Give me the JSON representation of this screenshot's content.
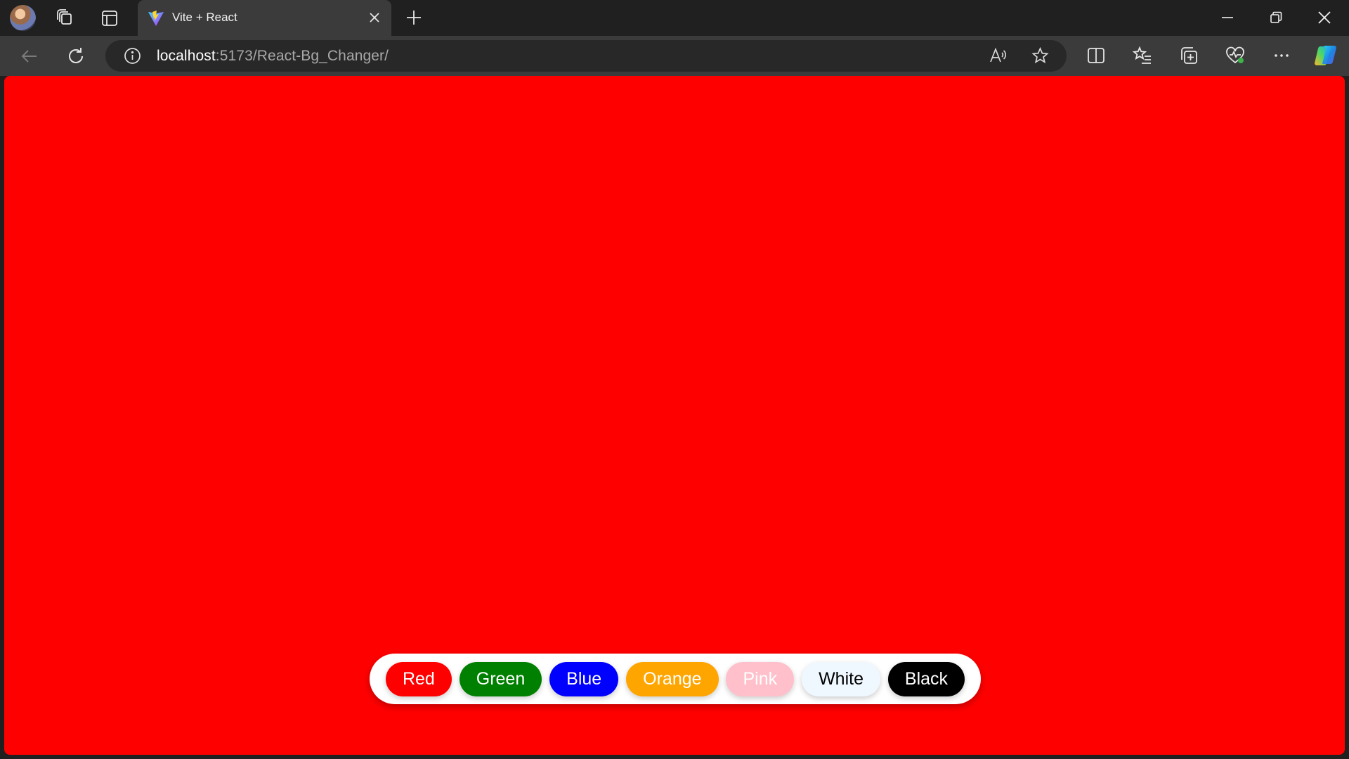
{
  "browser": {
    "tab": {
      "title": "Vite + React"
    },
    "address": {
      "host": "localhost",
      "path": ":5173/React-Bg_Changer/"
    }
  },
  "page": {
    "background_color": "#ff0000",
    "buttons": [
      {
        "label": "Red",
        "bg": "#ff0000",
        "fg": "#ffffff"
      },
      {
        "label": "Green",
        "bg": "#008000",
        "fg": "#ffffff"
      },
      {
        "label": "Blue",
        "bg": "#0000ff",
        "fg": "#ffffff"
      },
      {
        "label": "Orange",
        "bg": "#ffa500",
        "fg": "#ffffff"
      },
      {
        "label": "Pink",
        "bg": "#ffc0cb",
        "fg": "#ffffff"
      },
      {
        "label": "White",
        "bg": "#f0f8ff",
        "fg": "#000000"
      },
      {
        "label": "Black",
        "bg": "#000000",
        "fg": "#ffffff"
      }
    ]
  },
  "icons": {
    "titlebar": [
      "profile-avatar",
      "workspaces-icon",
      "tab-actions-icon"
    ],
    "toolbar": [
      "back-icon",
      "refresh-icon",
      "info-icon",
      "read-aloud-icon",
      "favorite-star-icon",
      "split-screen-icon",
      "favorites-icon",
      "collections-icon",
      "browser-essentials-icon",
      "more-icon",
      "copilot-icon"
    ]
  }
}
